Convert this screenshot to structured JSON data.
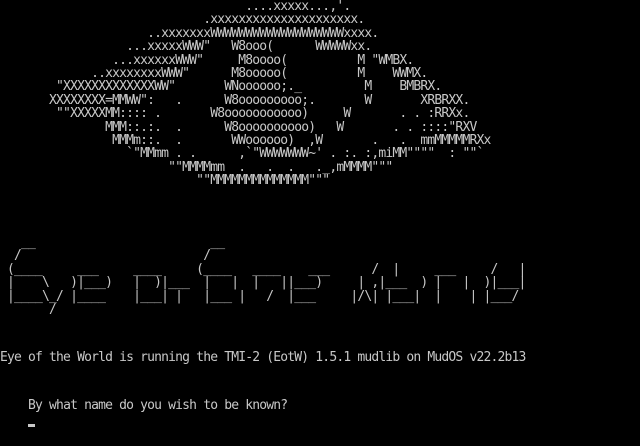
{
  "terminal": {
    "background": "#000000",
    "foreground": "#c8c8c8",
    "eye_art": "                                   ....xxxxx...,'.\n                             .xxxxxxxxxxxxxxxxxxxxx.\n                     ..xxxxxxxWWWWWWWWWWWWWWWWWWWxxxx.\n                  ...xxxxxWWW\"   W8ooo(      WWWWWxx.\n                ...xxxxxxWWW\"     M8oooo(          M \"WMBX.\n             ..xxxxxxxxWWW\"      M8ooooo(          M    WWMX.\n        \"XXXXXXXXXXXXXWW\"       WNoooooo;._         M    BMBRX.\n       XXXXXXXX=MMWW\":   .      W8ooooooooo;.       W       XRBRXX.\n        \"\"XXXXXMM:::: .       W8ooooooooooo)     W       . . :RRXx.\n               MMM::.:.  .      W8oooooooooo)   W       . . ::::\"RXV\n                MMMm::.  .       WWoooooo)  ,W       .   .  mmMMMMMRXx\n                  `\"MMmm . .      ,`\"WWWWWWW~' . :. :,miMM\"\"\"\"  : \"\"`\n                        \"\"MMMMmm  .   .  .   ._,mMMMM\"\"\"\n                            \"\"MMMMMMMMMMMMMM\"\"\"",
    "title_art": "   __                         __\n  /                          /\n (____     ___     ____     (____   ____    ___      /  |     ___     /   |\n |    \\   )|___)   |  )|___  |   |  |   ||___)     | ,|___  ) |   |  )|___|\n |____\\_/ |____    |___| |   |___ |   /  |___     |/\\| |___|  |    | |___/\n       /",
    "status_line": "Eye of the World is running the TMI-2 (EotW) 1.5.1 mudlib on MudOS v22.2b13",
    "prompt_line": "By what name do you wish to be known?"
  }
}
